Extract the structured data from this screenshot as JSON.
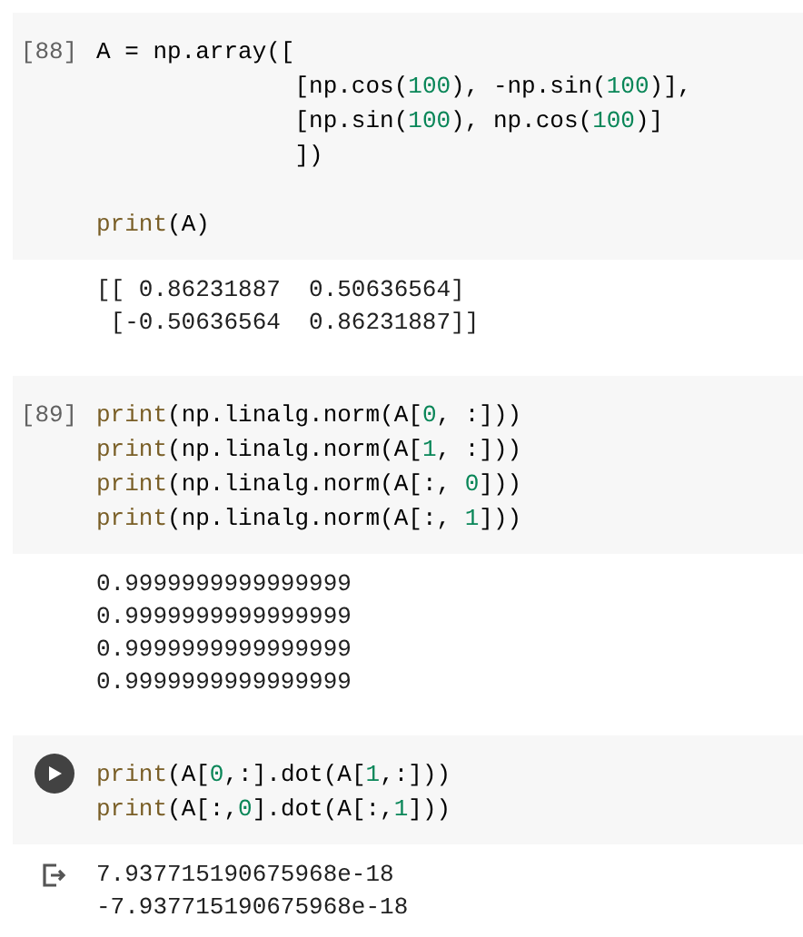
{
  "cells": [
    {
      "prompt": "[88]",
      "focused": false,
      "lines": [
        {
          "kind": "code",
          "tokens": [
            {
              "t": "A = np.array([",
              "kind": "plain"
            }
          ]
        },
        {
          "kind": "code",
          "tokens": [
            {
              "t": "              [np.cos(",
              "kind": "plain"
            },
            {
              "t": "100",
              "kind": "num"
            },
            {
              "t": "), -np.sin(",
              "kind": "plain"
            },
            {
              "t": "100",
              "kind": "num"
            },
            {
              "t": ")],",
              "kind": "plain"
            }
          ]
        },
        {
          "kind": "code",
          "tokens": [
            {
              "t": "              [np.sin(",
              "kind": "plain"
            },
            {
              "t": "100",
              "kind": "num"
            },
            {
              "t": "), np.cos(",
              "kind": "plain"
            },
            {
              "t": "100",
              "kind": "num"
            },
            {
              "t": ")]",
              "kind": "plain"
            }
          ]
        },
        {
          "kind": "code",
          "tokens": [
            {
              "t": "              ])",
              "kind": "plain"
            }
          ]
        },
        {
          "kind": "blank"
        },
        {
          "kind": "code",
          "tokens": [
            {
              "t": "print",
              "kind": "fn"
            },
            {
              "t": "(A)",
              "kind": "plain"
            }
          ]
        }
      ],
      "output": [
        "[[ 0.86231887  0.50636564]",
        " [-0.50636564  0.86231887]]"
      ]
    },
    {
      "prompt": "[89]",
      "focused": false,
      "lines": [
        {
          "kind": "code",
          "tokens": [
            {
              "t": "print",
              "kind": "fn"
            },
            {
              "t": "(np.linalg.norm(A[",
              "kind": "plain"
            },
            {
              "t": "0",
              "kind": "num"
            },
            {
              "t": ", :]))",
              "kind": "plain"
            }
          ]
        },
        {
          "kind": "code",
          "tokens": [
            {
              "t": "print",
              "kind": "fn"
            },
            {
              "t": "(np.linalg.norm(A[",
              "kind": "plain"
            },
            {
              "t": "1",
              "kind": "num"
            },
            {
              "t": ", :]))",
              "kind": "plain"
            }
          ]
        },
        {
          "kind": "code",
          "tokens": [
            {
              "t": "print",
              "kind": "fn"
            },
            {
              "t": "(np.linalg.norm(A[:, ",
              "kind": "plain"
            },
            {
              "t": "0",
              "kind": "num"
            },
            {
              "t": "]))",
              "kind": "plain"
            }
          ]
        },
        {
          "kind": "code",
          "tokens": [
            {
              "t": "print",
              "kind": "fn"
            },
            {
              "t": "(np.linalg.norm(A[:, ",
              "kind": "plain"
            },
            {
              "t": "1",
              "kind": "num"
            },
            {
              "t": "]))",
              "kind": "plain"
            }
          ]
        }
      ],
      "output": [
        "0.9999999999999999",
        "0.9999999999999999",
        "0.9999999999999999",
        "0.9999999999999999"
      ]
    },
    {
      "focused": true,
      "lines": [
        {
          "kind": "code",
          "tokens": [
            {
              "t": "print",
              "kind": "fn"
            },
            {
              "t": "(A[",
              "kind": "plain"
            },
            {
              "t": "0",
              "kind": "num"
            },
            {
              "t": ",:].dot(A[",
              "kind": "plain"
            },
            {
              "t": "1",
              "kind": "num"
            },
            {
              "t": ",:]))",
              "kind": "plain"
            }
          ]
        },
        {
          "kind": "code",
          "tokens": [
            {
              "t": "print",
              "kind": "fn"
            },
            {
              "t": "(A[:,",
              "kind": "plain"
            },
            {
              "t": "0",
              "kind": "num"
            },
            {
              "t": "].dot(A[:,",
              "kind": "plain"
            },
            {
              "t": "1",
              "kind": "num"
            },
            {
              "t": "]))",
              "kind": "plain"
            }
          ]
        }
      ],
      "output": [
        "7.937715190675968e-18",
        "-7.937715190675968e-18"
      ]
    }
  ]
}
